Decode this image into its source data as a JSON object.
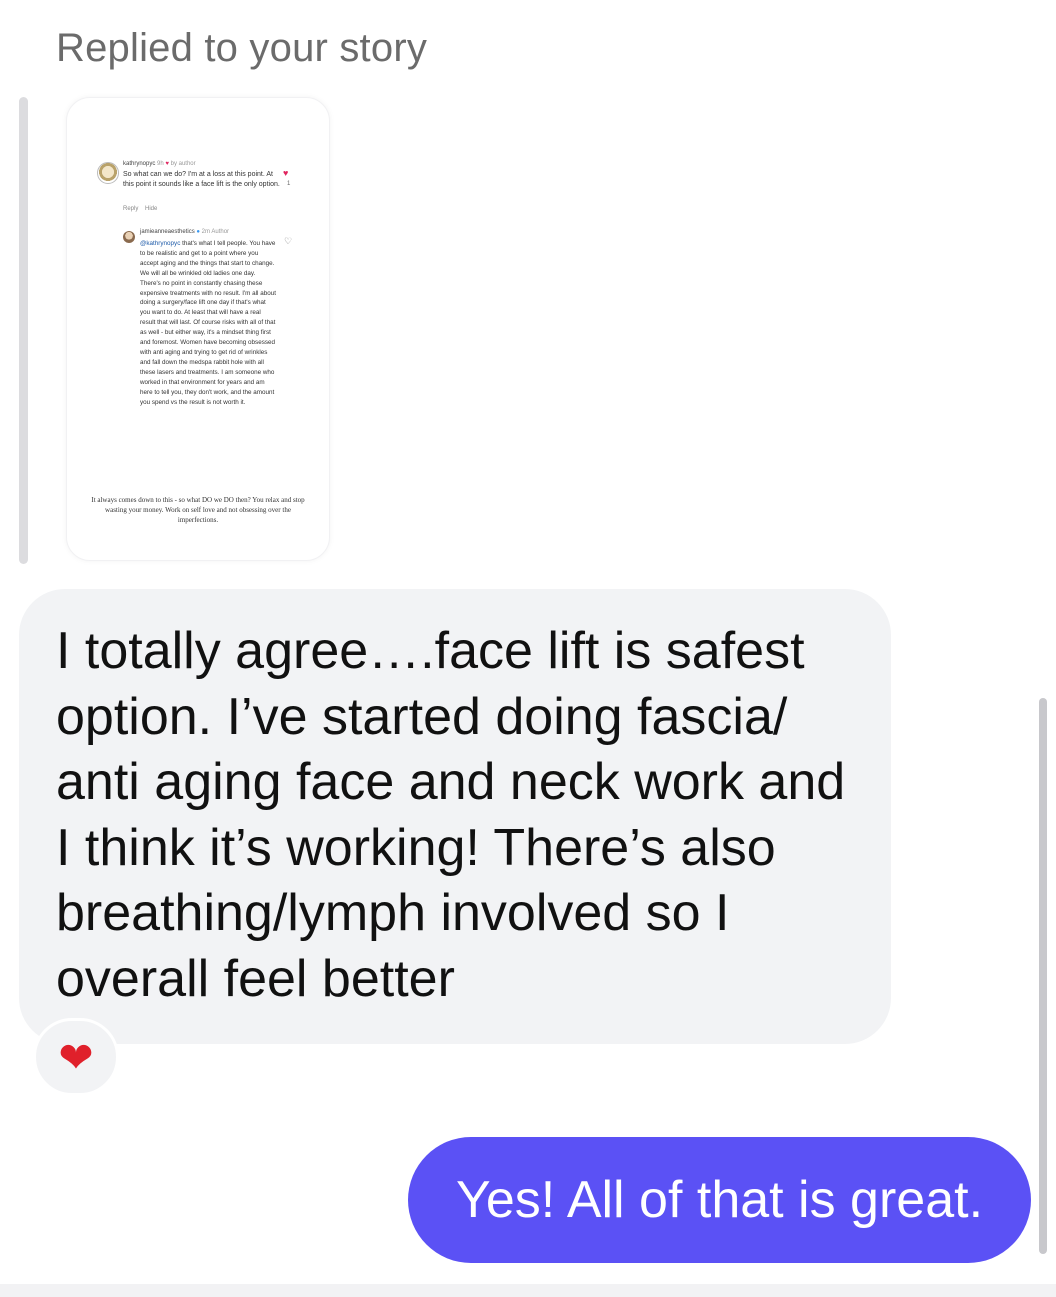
{
  "thread": {
    "reply_header": "Replied to your story",
    "story_preview": {
      "comment_1": {
        "username": "kathrynopyc",
        "time": "9h",
        "by_author": "by author",
        "text": "So what can we do? I'm at a loss at this point. At this point it sounds like a face lift is the only option.",
        "reply": "Reply",
        "hide": "Hide",
        "like_count": "1"
      },
      "comment_2": {
        "username": "jamieanneaesthetics",
        "time": "2m",
        "author_tag": "Author",
        "mention": "@kathrynopyc",
        "text": " that's what I tell people. You have to be realistic and get to a point where you accept aging and the things that start to change. We will all be wrinkled old ladies one day. There's no point in constantly chasing these expensive treatments with no result. I'm all about doing a surgery/face lift one day if that's what you want to do. At least that will have a real result that will last. Of course risks with all of that as well - but either way, it's a mindset thing first and foremost. Women have becoming obsessed with anti aging and trying to get rid of wrinkles and fall down the medspa rabbit hole with all these lasers and treatments. I am someone who worked in that environment for years and am here to tell you, they don't work, and the amount you spend vs the result is not worth it."
      },
      "caption": "It always comes down to this - so what DO we DO then? You relax and stop wasting your money. Work on self love and not obsessing over the imperfections."
    },
    "incoming_message": "I totally agree….face lift is safest option. I’ve started doing fascia/ anti aging face and neck work and I think it’s working! There’s also breathing/lymph involved so I overall feel better",
    "reaction": "❤",
    "outgoing_message": "Yes! All of that is great."
  },
  "colors": {
    "outgoing_bubble": "#5b51f5",
    "incoming_bubble": "#f2f3f5",
    "header_text": "#6b6b6b",
    "reaction_heart": "#e0202b"
  }
}
